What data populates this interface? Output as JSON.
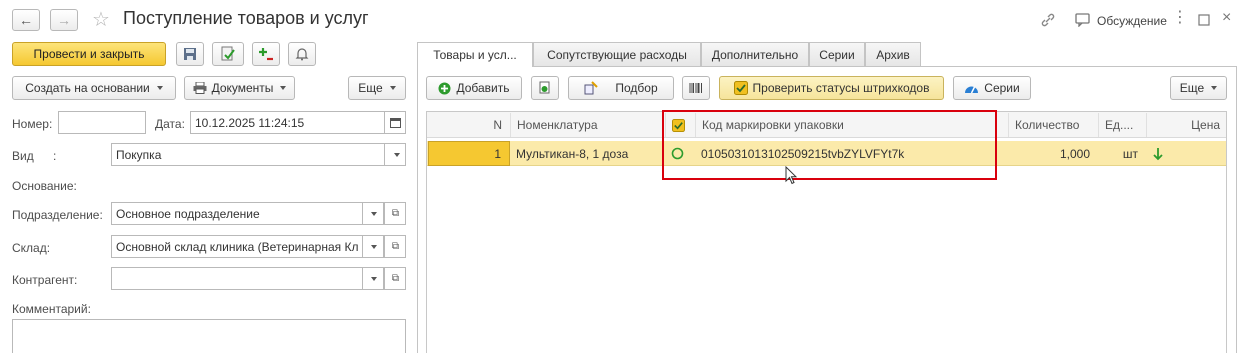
{
  "window": {
    "title": "Поступление товаров и услуг",
    "discussion_label": "Обсуждение"
  },
  "toolbar": {
    "post_close_label": "Провести и закрыть",
    "create_based_label": "Создать на основании",
    "documents_label": "Документы",
    "more_label": "Еще"
  },
  "form": {
    "number_label": "Номер:",
    "number_value": "",
    "date_label": "Дата:",
    "date_value": "10.12.2025 11:24:15",
    "kind_label": "Вид",
    "kind_colon": ":",
    "kind_value": "Покупка",
    "basis_label": "Основание:",
    "division_label": "Подразделение:",
    "division_value": "Основное подразделение",
    "warehouse_label": "Склад:",
    "warehouse_value": "Основной склад клиника (Ветеринарная Кл",
    "counterparty_label": "Контрагент:",
    "counterparty_value": "",
    "comment_label": "Комментарий:",
    "comment_value": ""
  },
  "tabs": [
    {
      "label": "Товары и усл..."
    },
    {
      "label": "Сопутствующие расходы"
    },
    {
      "label": "Дополнительно"
    },
    {
      "label": "Серии"
    },
    {
      "label": "Архив"
    }
  ],
  "table_toolbar": {
    "add_label": "Добавить",
    "pick_label": "Подбор",
    "check_status_label": "Проверить статусы штрихкодов",
    "series_label": "Серии",
    "more_label": "Еще"
  },
  "table": {
    "columns": {
      "n": "N",
      "nomenclature": "Номенклатура",
      "code": "Код маркировки упаковки",
      "quantity": "Количество",
      "unit": "Ед....",
      "price": "Цена"
    },
    "rows": [
      {
        "n": "1",
        "nomenclature": "Мультикан-8, 1 доза",
        "code": "0105031013102509215tvbZYLVFYt7k",
        "quantity": "1,000",
        "unit": "шт"
      }
    ]
  },
  "colors": {
    "accent_yellow": "#f5c831",
    "selected_row": "#fbeaaa",
    "highlight_box": "#d9000d",
    "status_green": "#2d9b2d"
  }
}
